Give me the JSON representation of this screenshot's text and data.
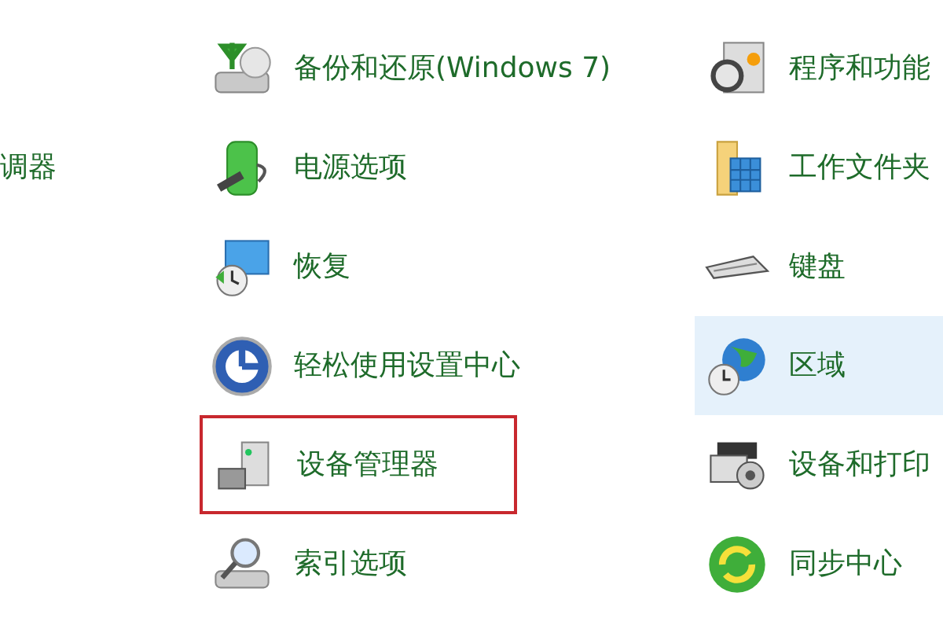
{
  "columns": [
    {
      "items": [
        {
          "label": "调器",
          "selected": false,
          "marked": false
        }
      ]
    },
    {
      "items": [
        {
          "label": "备份和还原(Windows 7)",
          "selected": false,
          "marked": false
        },
        {
          "label": "电源选项",
          "selected": false,
          "marked": false
        },
        {
          "label": "恢复",
          "selected": false,
          "marked": false
        },
        {
          "label": "轻松使用设置中心",
          "selected": false,
          "marked": false
        },
        {
          "label": "设备管理器",
          "selected": false,
          "marked": true
        },
        {
          "label": "索引选项",
          "selected": false,
          "marked": false
        }
      ]
    },
    {
      "items": [
        {
          "label": "程序和功能",
          "selected": false,
          "marked": false
        },
        {
          "label": "工作文件夹",
          "selected": false,
          "marked": false
        },
        {
          "label": "键盘",
          "selected": false,
          "marked": false
        },
        {
          "label": "区域",
          "selected": true,
          "marked": false
        },
        {
          "label": "设备和打印",
          "selected": false,
          "marked": false
        },
        {
          "label": "同步中心",
          "selected": false,
          "marked": false
        }
      ]
    }
  ]
}
